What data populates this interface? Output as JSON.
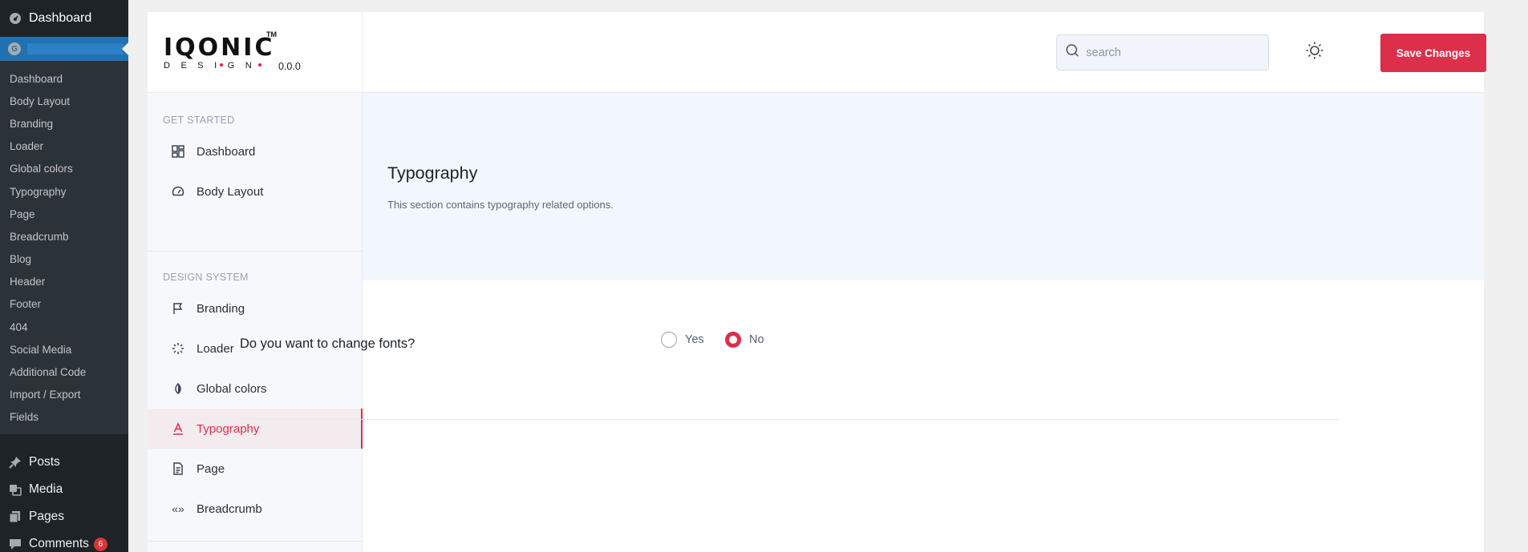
{
  "wp": {
    "dashboard": "Dashboard",
    "submenu": [
      "Dashboard",
      "Body Layout",
      "Branding",
      "Loader",
      "Global colors",
      "Typography",
      "Page",
      "Breadcrumb",
      "Blog",
      "Header",
      "Footer",
      "404",
      "Social Media",
      "Additional Code",
      "Import / Export",
      "Fields"
    ],
    "main": [
      {
        "label": "Posts",
        "icon": "pin-icon"
      },
      {
        "label": "Media",
        "icon": "media-icon"
      },
      {
        "label": "Pages",
        "icon": "pages-icon"
      },
      {
        "label": "Comments",
        "icon": "comment-icon",
        "badge": "6"
      }
    ]
  },
  "brand": {
    "word": "IQONIC",
    "tm": "TM",
    "sub": "DESIGN",
    "version": "0.0.0"
  },
  "header": {
    "search_placeholder": "search",
    "save_label": "Save Changes"
  },
  "nav": {
    "group1": "GET STARTED",
    "group2": "DESIGN SYSTEM",
    "items": [
      {
        "label": "Dashboard",
        "icon": "dashboard-grid-icon"
      },
      {
        "label": "Body Layout",
        "icon": "gauge-icon"
      },
      {
        "label": "Branding",
        "icon": "flag-icon"
      },
      {
        "label": "Loader",
        "icon": "loader-icon"
      },
      {
        "label": "Global colors",
        "icon": "contrast-icon"
      },
      {
        "label": "Typography",
        "icon": "typography-icon",
        "active": true
      },
      {
        "label": "Page",
        "icon": "page-icon"
      },
      {
        "label": "Breadcrumb",
        "icon": "breadcrumb-icon"
      }
    ]
  },
  "section": {
    "title": "Typography",
    "description": "This section contains typography related options."
  },
  "option": {
    "question": "Do you want to change fonts?",
    "yes": "Yes",
    "no": "No",
    "selected": "No"
  },
  "colors": {
    "accent": "#dc2f4b",
    "wp_sidebar": "#1d2327",
    "wp_active": "#2271b1"
  }
}
